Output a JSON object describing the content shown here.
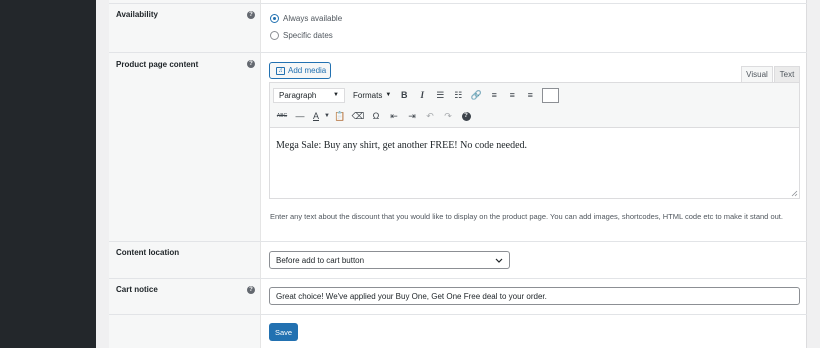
{
  "colors": {
    "accent": "#2271b1",
    "admin_menu": "#23272b"
  },
  "availability": {
    "label": "Availability",
    "help_icon": "?",
    "options": [
      {
        "label": "Always available",
        "checked": true
      },
      {
        "label": "Specific dates",
        "checked": false
      }
    ]
  },
  "product_page_content": {
    "label": "Product page content",
    "help_icon": "?",
    "add_media_label": "Add media",
    "tabs": {
      "visual": "Visual",
      "text": "Text"
    },
    "toolbar": {
      "paragraph_select": "Paragraph",
      "formats_label": "Formats",
      "bold": "B",
      "italic": "I",
      "strikethrough": "ABC",
      "text_color": "A",
      "special_char": "Ω"
    },
    "editor_text": "Mega Sale: Buy any shirt, get another FREE! No code needed.",
    "description": "Enter any text about the discount that you would like to display on the product page. You can add images, shortcodes, HTML code etc to make it stand out."
  },
  "content_location": {
    "label": "Content location",
    "selected": "Before add to cart button"
  },
  "cart_notice": {
    "label": "Cart notice",
    "help_icon": "?",
    "value": "Great choice! We've applied your Buy One, Get One Free deal to your order."
  },
  "save_label": "Save"
}
